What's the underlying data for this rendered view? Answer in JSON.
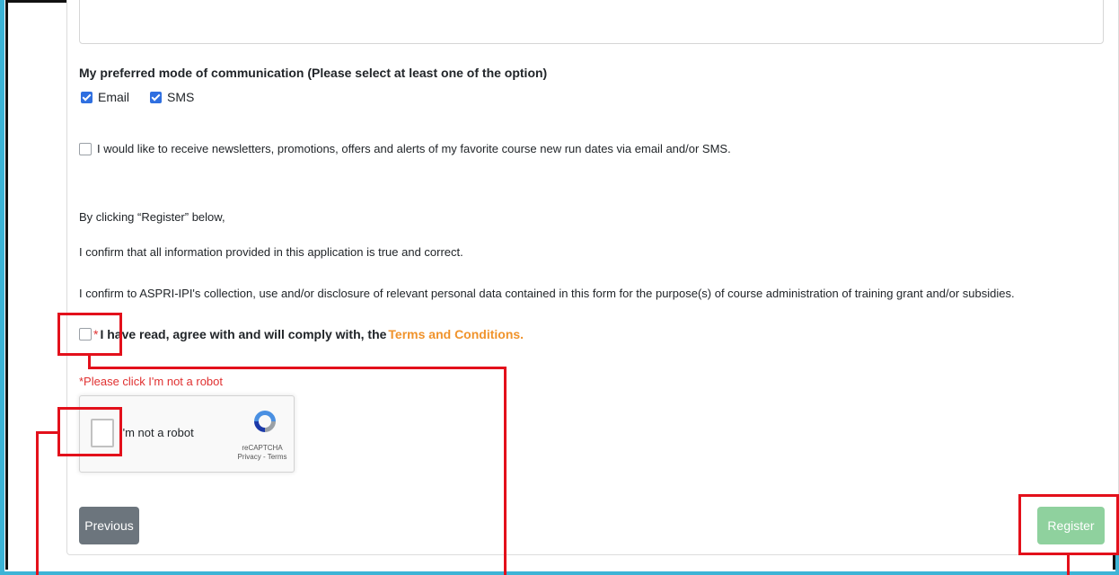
{
  "communication": {
    "title": "My preferred mode of communication (Please select at least one of the option)",
    "options": [
      {
        "label": "Email",
        "checked": true
      },
      {
        "label": "SMS",
        "checked": true
      }
    ]
  },
  "newsletter": {
    "label": "I would like to receive newsletters, promotions, offers and alerts of my favorite course new run dates via email and/or SMS.",
    "checked": false
  },
  "declaration": {
    "intro": "By clicking “Register” below,",
    "line1": "I confirm that all information provided in this application is true and correct.",
    "line2": "I confirm to ASPRI-IPI's collection, use and/or disclosure of relevant personal data contained in this form for the purpose(s) of course administration of training grant and/or subsidies."
  },
  "terms": {
    "required_mark": "*",
    "text": "I have read, agree with and will comply with, the ",
    "link": "Terms and Conditions.",
    "checked": false
  },
  "recaptcha": {
    "error": "*Please click I'm not a robot",
    "label": "I'm not a robot",
    "brand": "reCAPTCHA",
    "links": "Privacy - Terms"
  },
  "buttons": {
    "previous": "Previous",
    "register": "Register"
  },
  "colors": {
    "frame": "#3db4d6",
    "checkbox_checked": "#2f6fe0",
    "error": "#e03131",
    "link": "#f0932b",
    "previous_button": "#6c757d",
    "register_button": "#8fd19e",
    "annotation": "#e3101b"
  }
}
